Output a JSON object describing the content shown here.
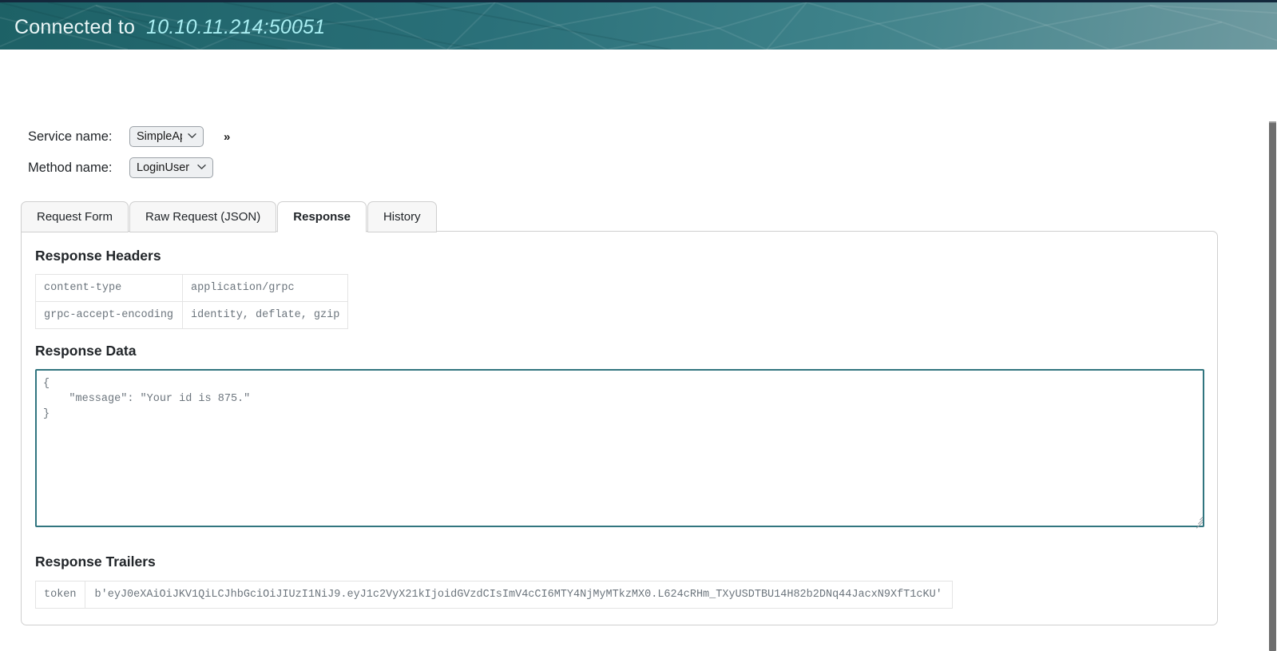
{
  "banner": {
    "label": "Connected to",
    "address": "10.10.11.214:50051",
    "accent_color": "#2a7079",
    "address_color": "#a8eef2"
  },
  "form": {
    "service": {
      "label": "Service name:",
      "value": "SimpleApp",
      "options": [
        "SimpleApp"
      ],
      "chevron": "chevron-down-icon"
    },
    "method": {
      "label": "Method name:",
      "value": "LoginUser",
      "options": [
        "LoginUser"
      ],
      "chevron": "chevron-down-icon"
    },
    "expand_more_label": "»"
  },
  "tabs": [
    {
      "label": "Request Form",
      "active": false
    },
    {
      "label": "Raw Request (JSON)",
      "active": false
    },
    {
      "label": "Response",
      "active": true
    },
    {
      "label": "History",
      "active": false
    }
  ],
  "response": {
    "headers_title": "Response Headers",
    "headers": [
      {
        "key": "content-type",
        "value": "application/grpc"
      },
      {
        "key": "grpc-accept-encoding",
        "value": "identity, deflate, gzip"
      }
    ],
    "data_title": "Response Data",
    "data_value": "{\n    \"message\": \"Your id is 875.\"\n}",
    "data_border_color": "#31757f",
    "trailers_title": "Response Trailers",
    "trailers": [
      {
        "key": "token",
        "value": "b'eyJ0eXAiOiJKV1QiLCJhbGciOiJIUzI1NiJ9.eyJ1c2VyX21kIjoidGVzdCIsImV4cCI6MTY4NjMyMTkzMX0.L624cRHm_TXyUSDTBU14H82b2DNq44JacxN9XfT1cKU'"
      }
    ]
  }
}
